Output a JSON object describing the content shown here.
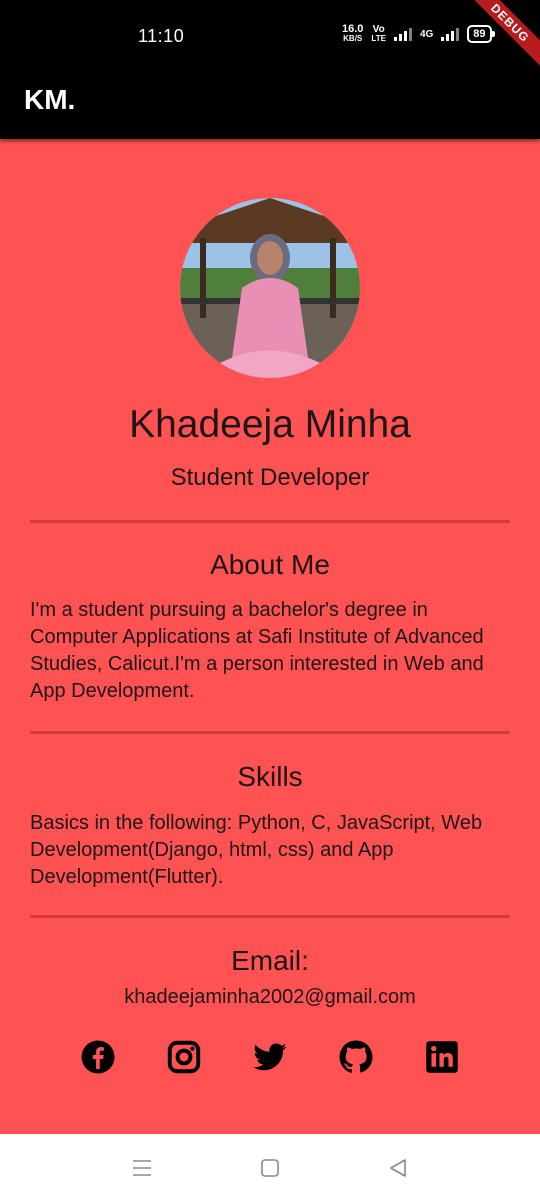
{
  "status_bar": {
    "time": "11:10",
    "net_speed_value": "16.0",
    "net_speed_unit": "KB/S",
    "volte_top": "Vo",
    "volte_bottom": "LTE",
    "network_4g": "4G",
    "battery": "89"
  },
  "debug_banner": "DEBUG",
  "app_bar": {
    "title": "KM."
  },
  "profile": {
    "name": "Khadeeja Minha",
    "role": "Student Developer"
  },
  "about": {
    "title": "About Me",
    "text": "I'm a student pursuing a bachelor's degree in Computer Applications at Safi Institute of Advanced Studies, Calicut.I'm a person interested in Web and App Development."
  },
  "skills": {
    "title": "Skills",
    "text": "Basics in the following: Python, C, JavaScript, Web Development(Django, html, css) and App Development(Flutter)."
  },
  "contact": {
    "title": "Email:",
    "email": "khadeejaminha2002@gmail.com"
  },
  "socials": [
    "facebook-icon",
    "instagram-icon",
    "twitter-icon",
    "github-icon",
    "linkedin-icon"
  ],
  "colors": {
    "background": "#ff5252",
    "app_bar": "#000000",
    "divider": "#d73a3a",
    "text": "#1e1616"
  }
}
